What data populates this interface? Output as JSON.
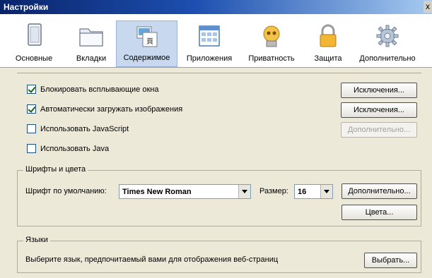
{
  "window": {
    "title": "Настройки",
    "close_label": "x"
  },
  "toolbar": {
    "categories": [
      {
        "label": "Основные",
        "icon": "general-window-icon"
      },
      {
        "label": "Вкладки",
        "icon": "tabs-folder-icon"
      },
      {
        "label": "Содержимое",
        "icon": "content-pictures-icon"
      },
      {
        "label": "Приложения",
        "icon": "applications-icon"
      },
      {
        "label": "Приватность",
        "icon": "privacy-mask-icon"
      },
      {
        "label": "Защита",
        "icon": "security-lock-icon"
      },
      {
        "label": "Дополнительно",
        "icon": "advanced-gear-icon"
      }
    ],
    "active_index": 2
  },
  "content": {
    "options": [
      {
        "label": "Блокировать всплывающие окна",
        "checked": true,
        "button": "Исключения...",
        "button_enabled": true
      },
      {
        "label": "Автоматически загружать изображения",
        "checked": true,
        "button": "Исключения...",
        "button_enabled": true
      },
      {
        "label": "Использовать JavaScript",
        "checked": false,
        "button": "Дополнительно...",
        "button_enabled": false
      },
      {
        "label": "Использовать Java",
        "checked": false
      }
    ],
    "fonts": {
      "title": "Шрифты и цвета",
      "default_font_label": "Шрифт по умолчанию:",
      "default_font_value": "Times New Roman",
      "size_label": "Размер:",
      "size_value": "16",
      "advanced_button": "Дополнительно...",
      "colors_button": "Цвета..."
    },
    "languages": {
      "title": "Языки",
      "description": "Выберите язык, предпочитаемый вами для отображения веб-страниц",
      "choose_button": "Выбрать..."
    }
  },
  "colors": {
    "titlebar_start": "#0a246a",
    "titlebar_end": "#a6caf0",
    "active_tab": "#c7d8ef",
    "window_bg": "#ece9d8"
  }
}
